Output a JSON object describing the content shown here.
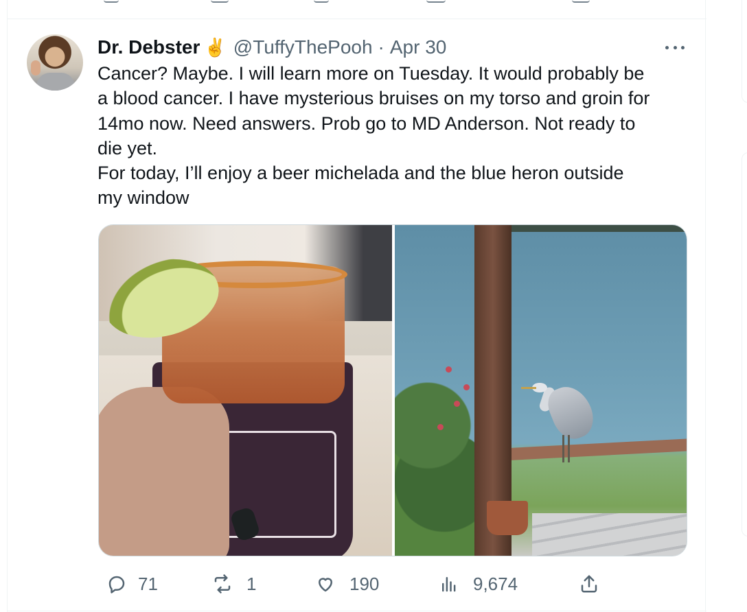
{
  "tweet": {
    "author": {
      "display_name": "Dr. Debster",
      "badge_emoji": "✌️",
      "handle": "@TuffyThePooh",
      "separator": "·",
      "date": "Apr 30"
    },
    "text": "Cancer? Maybe. I will learn more on Tuesday. It would probably be\na blood cancer. I have mysterious bruises on my torso and groin for\n14mo now. Need answers. Prob go to MD Anderson. Not ready to\ndie yet.\nFor today, I’ll enjoy a beer michelada and the blue heron outside\nmy window",
    "media": [
      {
        "kind": "photo",
        "subject": "michelada-in-koozie"
      },
      {
        "kind": "photo",
        "subject": "blue-heron-by-water"
      }
    ],
    "actions": {
      "replies": "71",
      "retweets": "1",
      "likes": "190",
      "views": "9,674"
    },
    "icons": {
      "more": "more-icon",
      "reply": "reply-icon",
      "retweet": "retweet-icon",
      "like": "heart-icon",
      "views": "views-icon",
      "share": "share-icon"
    }
  },
  "colors": {
    "text_primary": "#0f1419",
    "text_secondary": "#536471",
    "border": "#eff3f4"
  }
}
